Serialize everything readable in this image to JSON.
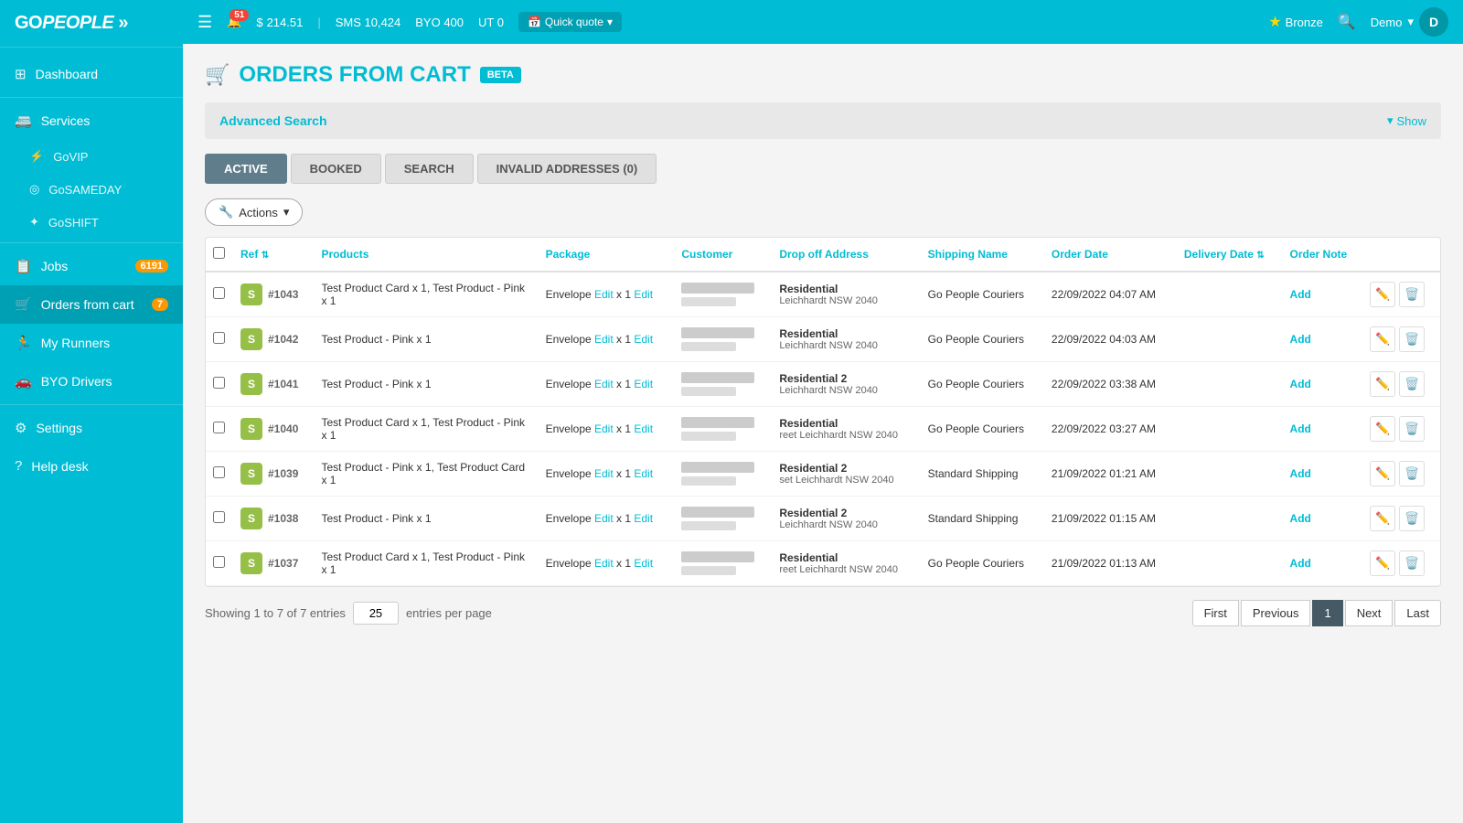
{
  "sidebar": {
    "logo": "GOPEOPLE",
    "nav_items": [
      {
        "id": "dashboard",
        "label": "Dashboard",
        "icon": "⊞",
        "badge": null,
        "active": false
      },
      {
        "id": "services",
        "label": "Services",
        "icon": "🚐",
        "badge": null,
        "active": false
      },
      {
        "id": "govip",
        "label": "GoVIP",
        "icon": "⚡",
        "badge": null,
        "active": false,
        "sub": true
      },
      {
        "id": "gosameday",
        "label": "GoSAMEDAY",
        "icon": "◎",
        "badge": null,
        "active": false,
        "sub": true
      },
      {
        "id": "goshift",
        "label": "GoSHIFT",
        "icon": "✦",
        "badge": null,
        "active": false,
        "sub": true
      },
      {
        "id": "jobs",
        "label": "Jobs",
        "icon": "📋",
        "badge": "6191",
        "active": false
      },
      {
        "id": "orders",
        "label": "Orders from cart",
        "icon": "🛒",
        "badge": "7",
        "active": true
      },
      {
        "id": "runners",
        "label": "My Runners",
        "icon": "🏃",
        "badge": null,
        "active": false
      },
      {
        "id": "byo",
        "label": "BYO Drivers",
        "icon": "🚗",
        "badge": null,
        "active": false
      },
      {
        "id": "settings",
        "label": "Settings",
        "icon": "⚙",
        "badge": null,
        "active": false
      },
      {
        "id": "helpdesk",
        "label": "Help desk",
        "icon": "?",
        "badge": null,
        "active": false
      }
    ]
  },
  "topbar": {
    "menu_icon": "☰",
    "bell_count": "51",
    "balance": "$ 214.51",
    "sms_label": "SMS 10,424",
    "byo_label": "BYO 400",
    "ut_label": "UT 0",
    "quick_quote": "Quick quote",
    "tier": "Bronze",
    "user": "Demo"
  },
  "page": {
    "title": "ORDERS FROM CART",
    "beta_label": "BETA",
    "advanced_search_label": "Advanced Search",
    "show_label": "Show"
  },
  "tabs": [
    {
      "id": "active",
      "label": "ACTIVE",
      "active": true
    },
    {
      "id": "booked",
      "label": "BOOKED",
      "active": false
    },
    {
      "id": "search",
      "label": "SEARCH",
      "active": false
    },
    {
      "id": "invalid",
      "label": "INVALID ADDRESSES (0)",
      "active": false
    }
  ],
  "actions_label": "Actions",
  "table": {
    "columns": [
      {
        "id": "ref",
        "label": "Ref",
        "sortable": true
      },
      {
        "id": "products",
        "label": "Products",
        "sortable": false
      },
      {
        "id": "package",
        "label": "Package",
        "sortable": false
      },
      {
        "id": "customer",
        "label": "Customer",
        "sortable": false
      },
      {
        "id": "dropoff",
        "label": "Drop off Address",
        "sortable": false
      },
      {
        "id": "shipping",
        "label": "Shipping Name",
        "sortable": false
      },
      {
        "id": "order_date",
        "label": "Order Date",
        "sortable": false
      },
      {
        "id": "delivery_date",
        "label": "Delivery Date",
        "sortable": true
      },
      {
        "id": "order_note",
        "label": "Order Note",
        "sortable": false
      }
    ],
    "rows": [
      {
        "ref": "#1043",
        "products": "Test Product Card x 1, Test Product - Pink x 1",
        "package": "Envelope",
        "package_edit1": "Edit",
        "package_x1": "x 1",
        "package_edit2": "Edit",
        "addr_bold": "Residential",
        "addr_sub": "Leichhardt NSW 2040",
        "shipping": "Go People Couriers",
        "order_date": "22/09/2022 04:07 AM",
        "add_label": "Add"
      },
      {
        "ref": "#1042",
        "products": "Test Product - Pink x 1",
        "package": "Envelope",
        "package_edit1": "Edit",
        "package_x1": "x 1",
        "package_edit2": "Edit",
        "addr_bold": "Residential",
        "addr_sub": "Leichhardt NSW 2040",
        "shipping": "Go People Couriers",
        "order_date": "22/09/2022 04:03 AM",
        "add_label": "Add"
      },
      {
        "ref": "#1041",
        "products": "Test Product - Pink x 1",
        "package": "Envelope",
        "package_edit1": "Edit",
        "package_x1": "x 1",
        "package_edit2": "Edit",
        "addr_bold": "Residential 2",
        "addr_sub": "Leichhardt NSW 2040",
        "shipping": "Go People Couriers",
        "order_date": "22/09/2022 03:38 AM",
        "add_label": "Add"
      },
      {
        "ref": "#1040",
        "products": "Test Product Card x 1, Test Product - Pink x 1",
        "package": "Envelope",
        "package_edit1": "Edit",
        "package_x1": "x 1",
        "package_edit2": "Edit",
        "addr_bold": "Residential",
        "addr_sub": "reet Leichhardt NSW 2040",
        "shipping": "Go People Couriers",
        "order_date": "22/09/2022 03:27 AM",
        "add_label": "Add"
      },
      {
        "ref": "#1039",
        "products": "Test Product - Pink x 1, Test Product Card x 1",
        "package": "Envelope",
        "package_edit1": "Edit",
        "package_x1": "x 1",
        "package_edit2": "Edit",
        "addr_bold": "Residential 2",
        "addr_sub": "set Leichhardt NSW 2040",
        "shipping": "Standard Shipping",
        "order_date": "21/09/2022 01:21 AM",
        "add_label": "Add"
      },
      {
        "ref": "#1038",
        "products": "Test Product - Pink x 1",
        "package": "Envelope",
        "package_edit1": "Edit",
        "package_x1": "x 1",
        "package_edit2": "Edit",
        "addr_bold": "Residential 2",
        "addr_sub": "Leichhardt NSW 2040",
        "shipping": "Standard Shipping",
        "order_date": "21/09/2022 01:15 AM",
        "add_label": "Add"
      },
      {
        "ref": "#1037",
        "products": "Test Product Card x 1, Test Product - Pink x 1",
        "package": "Envelope",
        "package_edit1": "Edit",
        "package_x1": "x 1",
        "package_edit2": "Edit",
        "addr_bold": "Residential",
        "addr_sub": "reet Leichhardt NSW 2040",
        "shipping": "Go People Couriers",
        "order_date": "21/09/2022 01:13 AM",
        "add_label": "Add"
      }
    ]
  },
  "pagination": {
    "showing_text": "Showing 1 to 7 of 7 entries",
    "entries_per_page": "25",
    "entries_label": "entries per page",
    "first_label": "First",
    "prev_label": "Previous",
    "current_page": "1",
    "next_label": "Next",
    "last_label": "Last"
  }
}
